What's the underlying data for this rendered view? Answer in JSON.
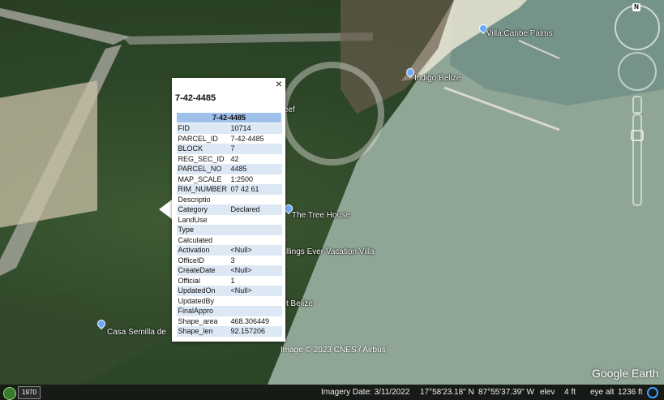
{
  "map": {
    "labels": {
      "villa_caribe": "Villa Caribe Palms",
      "indigo": "Indigo Belize",
      "tree_house": "The Tree House",
      "eef": "eef",
      "happy_ever": "llings Ever Vacation Villa",
      "t_belize": "t Belize",
      "casa_semilla": "Casa Semilla de"
    },
    "copyright": "Image © 2023 CNES / Airbus",
    "logo": "Google Earth"
  },
  "popup": {
    "title": "7-42-4485",
    "header": "7-42-4485",
    "close_glyph": "×",
    "rows": [
      {
        "key": "FID",
        "value": "10714"
      },
      {
        "key": "PARCEL_ID",
        "value": "7-42-4485"
      },
      {
        "key": "BLOCK",
        "value": "7"
      },
      {
        "key": "REG_SEC_ID",
        "value": "42"
      },
      {
        "key": "PARCEL_NO",
        "value": "4485"
      },
      {
        "key": "MAP_SCALE",
        "value": "1:2500"
      },
      {
        "key": "RIM_NUMBER",
        "value": "07 42 61"
      },
      {
        "key": "Descriptio",
        "value": ""
      },
      {
        "key": "Category",
        "value": "Declared"
      },
      {
        "key": "LandUse",
        "value": ""
      },
      {
        "key": "Type",
        "value": ""
      },
      {
        "key": "Calculated",
        "value": ""
      },
      {
        "key": "Activation",
        "value": "<Null>"
      },
      {
        "key": "OfficeID",
        "value": "3"
      },
      {
        "key": "CreateDate",
        "value": "<Null>"
      },
      {
        "key": "Official",
        "value": "1"
      },
      {
        "key": "UpdatedOn",
        "value": "<Null>"
      },
      {
        "key": "UpdatedBy",
        "value": ""
      },
      {
        "key": "FinalAppro",
        "value": ""
      },
      {
        "key": "Shape_area",
        "value": "468.306449"
      },
      {
        "key": "Shape_len",
        "value": "92.157206"
      }
    ]
  },
  "nav": {
    "compass_label": "N"
  },
  "statusbar": {
    "year": "1970",
    "imagery_date": "Imagery Date: 3/11/2022",
    "lat": "17°58'23.18\" N",
    "lon": "87°55'37.39\" W",
    "elev_label": "elev",
    "elev_value": "4 ft",
    "eye_label": "eye alt",
    "eye_value": "1236 ft"
  },
  "colors": {
    "table_header": "#9ec0ea",
    "row_alt": "#dde8f5",
    "sea": "#8fa596"
  }
}
